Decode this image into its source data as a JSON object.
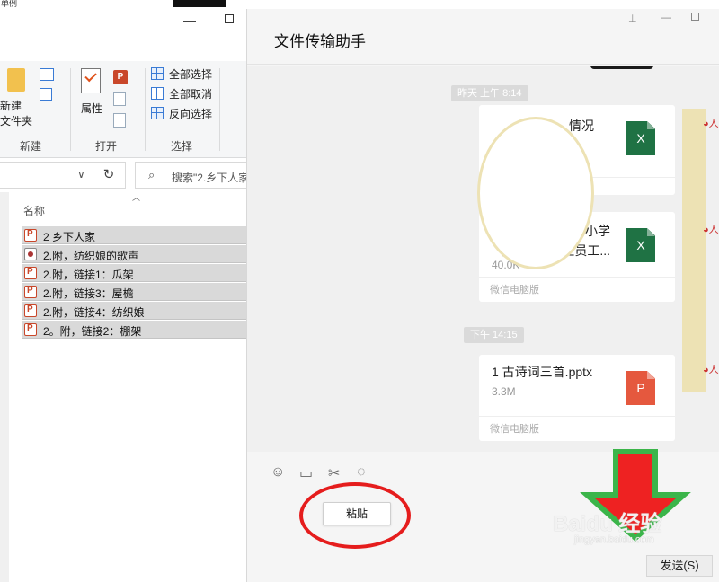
{
  "explorer": {
    "tab_partial": "单例",
    "ribbon": {
      "new_folder_label": "新建\n文件夹",
      "group_new": "新建",
      "properties_label": "属性",
      "group_open": "打开",
      "group_select": "选择",
      "select_all": "全部选择",
      "select_none": "全部取消",
      "invert_select": "反向选择"
    },
    "search_placeholder": "搜索\"2.乡下人家",
    "column_name": "名称",
    "files": [
      {
        "name": "2  乡下人家",
        "type": "ppt"
      },
      {
        "name": "2.附，纺织娘的歌声",
        "type": "audio"
      },
      {
        "name": "2.附，链接1：瓜架",
        "type": "ppt"
      },
      {
        "name": "2.附，链接3：屋檐",
        "type": "ppt"
      },
      {
        "name": "2.附，链接4：纺织娘",
        "type": "ppt"
      },
      {
        "name": "2。附，链接2：棚架",
        "type": "ppt"
      }
    ]
  },
  "wechat": {
    "title": "文件传输助手",
    "messages": [
      {
        "timestamp": "昨天 上午 8:14"
      },
      {
        "file_name": "情况",
        "file_type": "X",
        "source": ""
      },
      {
        "file_name": "小学\n省外　　　圣员工...",
        "file_size": "40.0K",
        "file_type": "X",
        "source": "微信电脑版"
      },
      {
        "timestamp": "下午 14:15"
      },
      {
        "file_name": "1 古诗词三首.pptx",
        "file_size": "3.3M",
        "file_type": "P",
        "source": "微信电脑版"
      }
    ],
    "paste_label": "粘贴",
    "send_label": "发送(S)",
    "watermark": "Baidu 经验",
    "watermark_url": "jingyan.baidu.com"
  },
  "colors": {
    "excel": "#1f7244",
    "powerpoint": "#e5583e",
    "annotation_red": "#e51d1d",
    "annotation_green": "#3bb54a"
  }
}
